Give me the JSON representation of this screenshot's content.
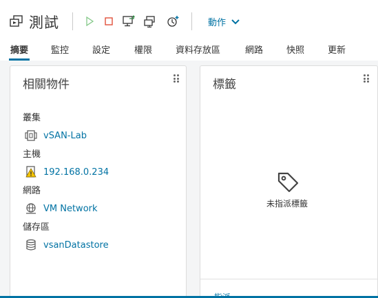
{
  "vm": {
    "name": "測試"
  },
  "toolbar": {
    "power_on": "play-icon",
    "power_off": "stop-icon",
    "console": "console-icon",
    "migrate": "migrate-icon",
    "snapshot": "snapshot-icon",
    "actions_label": "動作"
  },
  "tabs": [
    {
      "label": "摘要",
      "active": true
    },
    {
      "label": "監控"
    },
    {
      "label": "設定"
    },
    {
      "label": "權限"
    },
    {
      "label": "資料存放區"
    },
    {
      "label": "網路"
    },
    {
      "label": "快照"
    },
    {
      "label": "更新"
    }
  ],
  "related": {
    "title": "相關物件",
    "sections": [
      {
        "label": "叢集",
        "value": "vSAN-Lab",
        "icon": "cluster-icon"
      },
      {
        "label": "主機",
        "value": "192.168.0.234",
        "icon": "host-warning-icon"
      },
      {
        "label": "網路",
        "value": "VM Network",
        "icon": "network-icon"
      },
      {
        "label": "儲存區",
        "value": "vsanDatastore",
        "icon": "datastore-icon"
      }
    ]
  },
  "tags": {
    "title": "標籤",
    "empty_text": "未指派標籤",
    "assign_label": "指派"
  },
  "colors": {
    "accent": "#0072a3",
    "disabled_green": "#86c98a",
    "stop_red": "#e04f3a"
  }
}
